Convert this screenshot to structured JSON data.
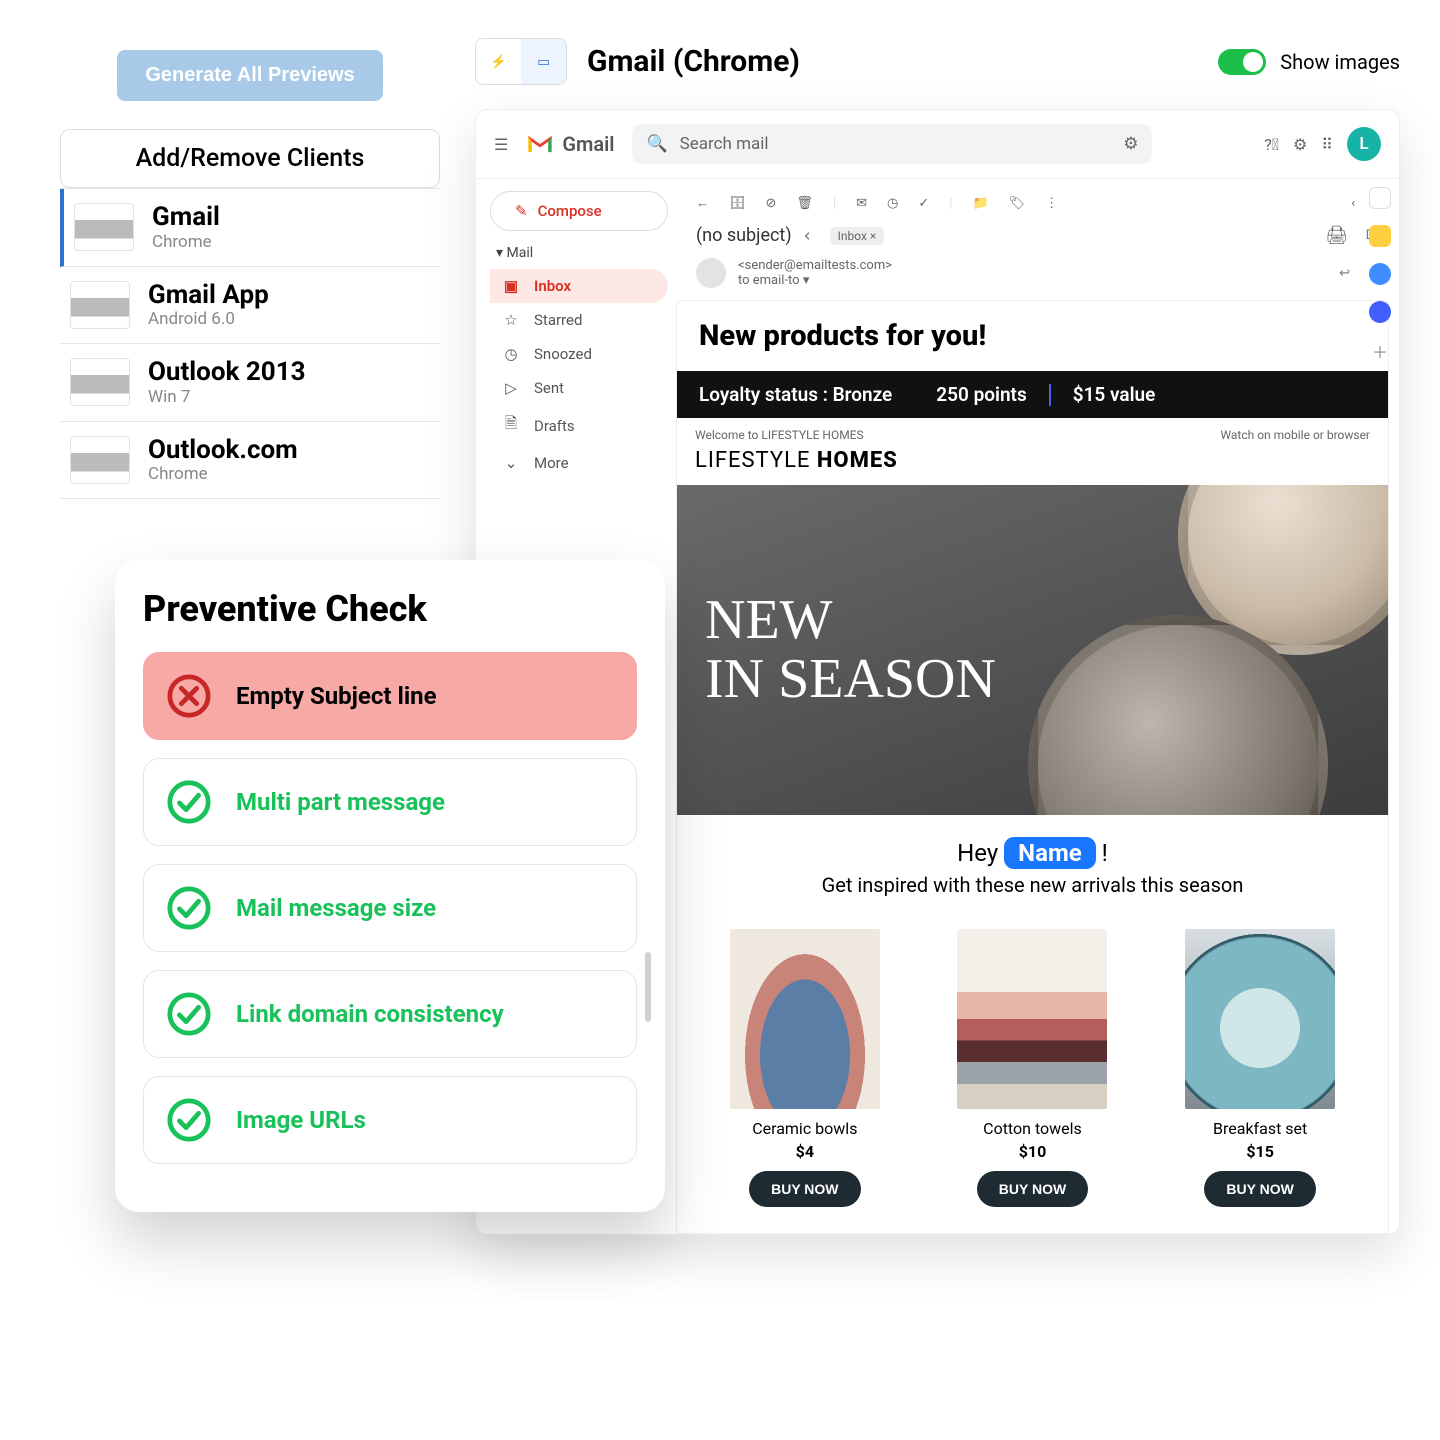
{
  "left": {
    "generate": "Generate All Previews",
    "add_remove": "Add/Remove Clients",
    "clients": [
      {
        "name": "Gmail",
        "sub": "Chrome"
      },
      {
        "name": "Gmail App",
        "sub": "Android 6.0"
      },
      {
        "name": "Outlook 2013",
        "sub": "Win 7"
      },
      {
        "name": "Outlook.com",
        "sub": "Chrome"
      }
    ]
  },
  "right": {
    "title": "Gmail (Chrome)",
    "show_images": "Show images"
  },
  "gmail": {
    "brand": "Gmail",
    "search_placeholder": "Search mail",
    "compose": "Compose",
    "section": "Mail",
    "nav": {
      "inbox": "Inbox",
      "starred": "Starred",
      "snoozed": "Snoozed",
      "sent": "Sent",
      "drafts": "Drafts",
      "more": "More"
    },
    "subject": "(no subject)",
    "label_chip": "Inbox ×",
    "from": "<sender@emailtests.com>",
    "to": "to email-to",
    "avatar_letter": "L"
  },
  "email": {
    "headline": "New products for you!",
    "loyalty_label": "Loyalty status : Bronze",
    "points": "250 points",
    "value": "$15 value",
    "welcome": "Welcome to LIFESTYLE HOMES",
    "watch": "Watch on mobile or browser",
    "brand_a": "LIFESTYLE ",
    "brand_b": "HOMES",
    "hero_l1": "NEW",
    "hero_l2": "IN SEASON",
    "greet_pre": "Hey ",
    "greet_name": "Name",
    "greet_post": " !",
    "subhead": "Get inspired with these new arrivals this season",
    "products": [
      {
        "name": "Ceramic bowls",
        "price": "$4",
        "buy": "BUY NOW"
      },
      {
        "name": "Cotton towels",
        "price": "$10",
        "buy": "BUY NOW"
      },
      {
        "name": "Breakfast set",
        "price": "$15",
        "buy": "BUY NOW"
      }
    ]
  },
  "pc": {
    "title": "Preventive Check",
    "items": [
      {
        "status": "err",
        "label": "Empty Subject line"
      },
      {
        "status": "ok",
        "label": "Multi part message"
      },
      {
        "status": "ok",
        "label": "Mail message size"
      },
      {
        "status": "ok",
        "label": "Link domain consistency"
      },
      {
        "status": "ok",
        "label": "Image URLs"
      }
    ]
  }
}
